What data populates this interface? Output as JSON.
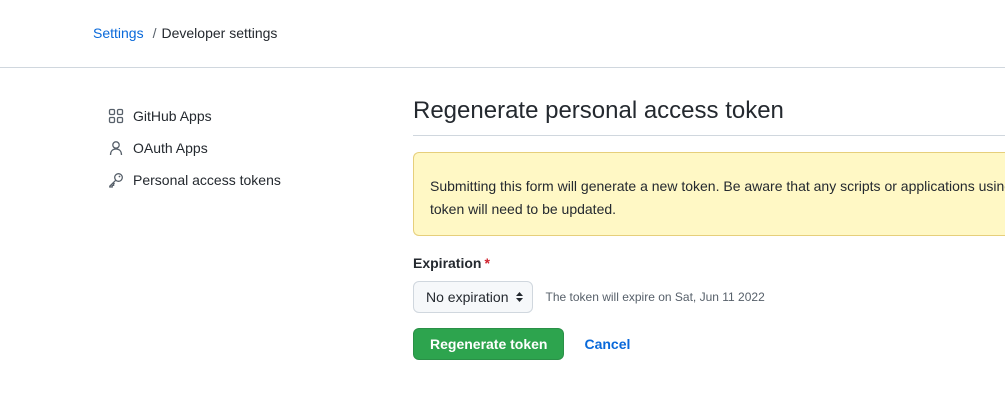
{
  "breadcrumb": {
    "parent": "Settings",
    "separator": "/",
    "current": "Developer settings"
  },
  "sidebar": {
    "items": [
      {
        "label": "GitHub Apps",
        "icon": "apps-grid-icon"
      },
      {
        "label": "OAuth Apps",
        "icon": "person-icon"
      },
      {
        "label": "Personal access tokens",
        "icon": "key-icon"
      }
    ]
  },
  "main": {
    "title": "Regenerate personal access token",
    "flash": "Submitting this form will generate a new token. Be aware that any scripts or applications using this token will need to be updated.",
    "expiration": {
      "label": "Expiration",
      "required_mark": "*",
      "selected": "No expiration",
      "note": "The token will expire on Sat, Jun 11 2022"
    },
    "actions": {
      "primary": "Regenerate token",
      "cancel": "Cancel"
    }
  },
  "colors": {
    "link": "#0969da",
    "primary_button": "#2da44e",
    "flash_bg": "#fff8c5",
    "required": "#cf222e"
  }
}
